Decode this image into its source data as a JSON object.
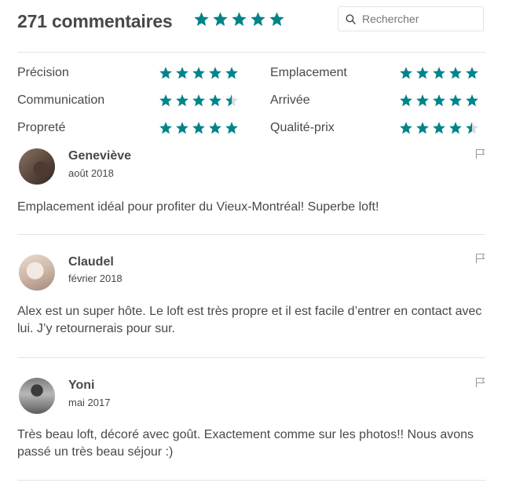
{
  "header": {
    "title": "271 commentaires",
    "overall_rating": 5,
    "search_placeholder": "Rechercher"
  },
  "ratings": [
    {
      "label": "Précision",
      "value": 5
    },
    {
      "label": "Emplacement",
      "value": 5
    },
    {
      "label": "Communication",
      "value": 4.5
    },
    {
      "label": "Arrivée",
      "value": 5
    },
    {
      "label": "Propreté",
      "value": 5
    },
    {
      "label": "Qualité-prix",
      "value": 4.5
    }
  ],
  "reviews": [
    {
      "name": "Geneviève",
      "date": "août 2018",
      "text": "Emplacement idéal pour profiter du Vieux-Montréal! Superbe loft!"
    },
    {
      "name": "Claudel",
      "date": "février 2018",
      "text": "Alex est un super hôte. Le loft est très propre et il est facile d’entrer en contact avec lui. J’y retournerais pour sur."
    },
    {
      "name": "Yoni",
      "date": "mai 2017",
      "text": "Très beau loft, décoré avec goût. Exactement comme sur les photos!! Nous avons passé un très beau séjour :)"
    }
  ],
  "colors": {
    "star": "#008489",
    "star_empty": "#d8d8d8",
    "text": "#484848",
    "divider": "#e4e4e4"
  },
  "icons": {
    "star": "star-icon",
    "search": "search-icon",
    "flag": "flag-icon"
  }
}
